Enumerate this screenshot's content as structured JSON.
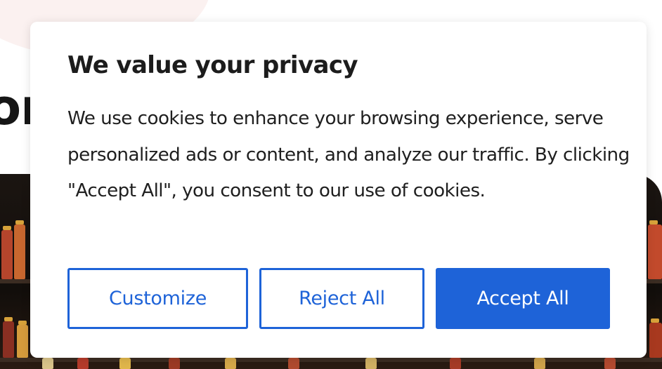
{
  "background": {
    "heading_fragment": "or"
  },
  "consent": {
    "title": "We value your privacy",
    "body": "We use cookies to enhance your browsing experience, serve personalized ads or content, and analyze our traffic. By clicking \"Accept All\", you consent to our use of cookies.",
    "buttons": {
      "customize": "Customize",
      "reject_all": "Reject All",
      "accept_all": "Accept All"
    }
  },
  "colors": {
    "accent": "#1e63d8",
    "text": "#1f1f1f",
    "card_background": "#ffffff"
  }
}
